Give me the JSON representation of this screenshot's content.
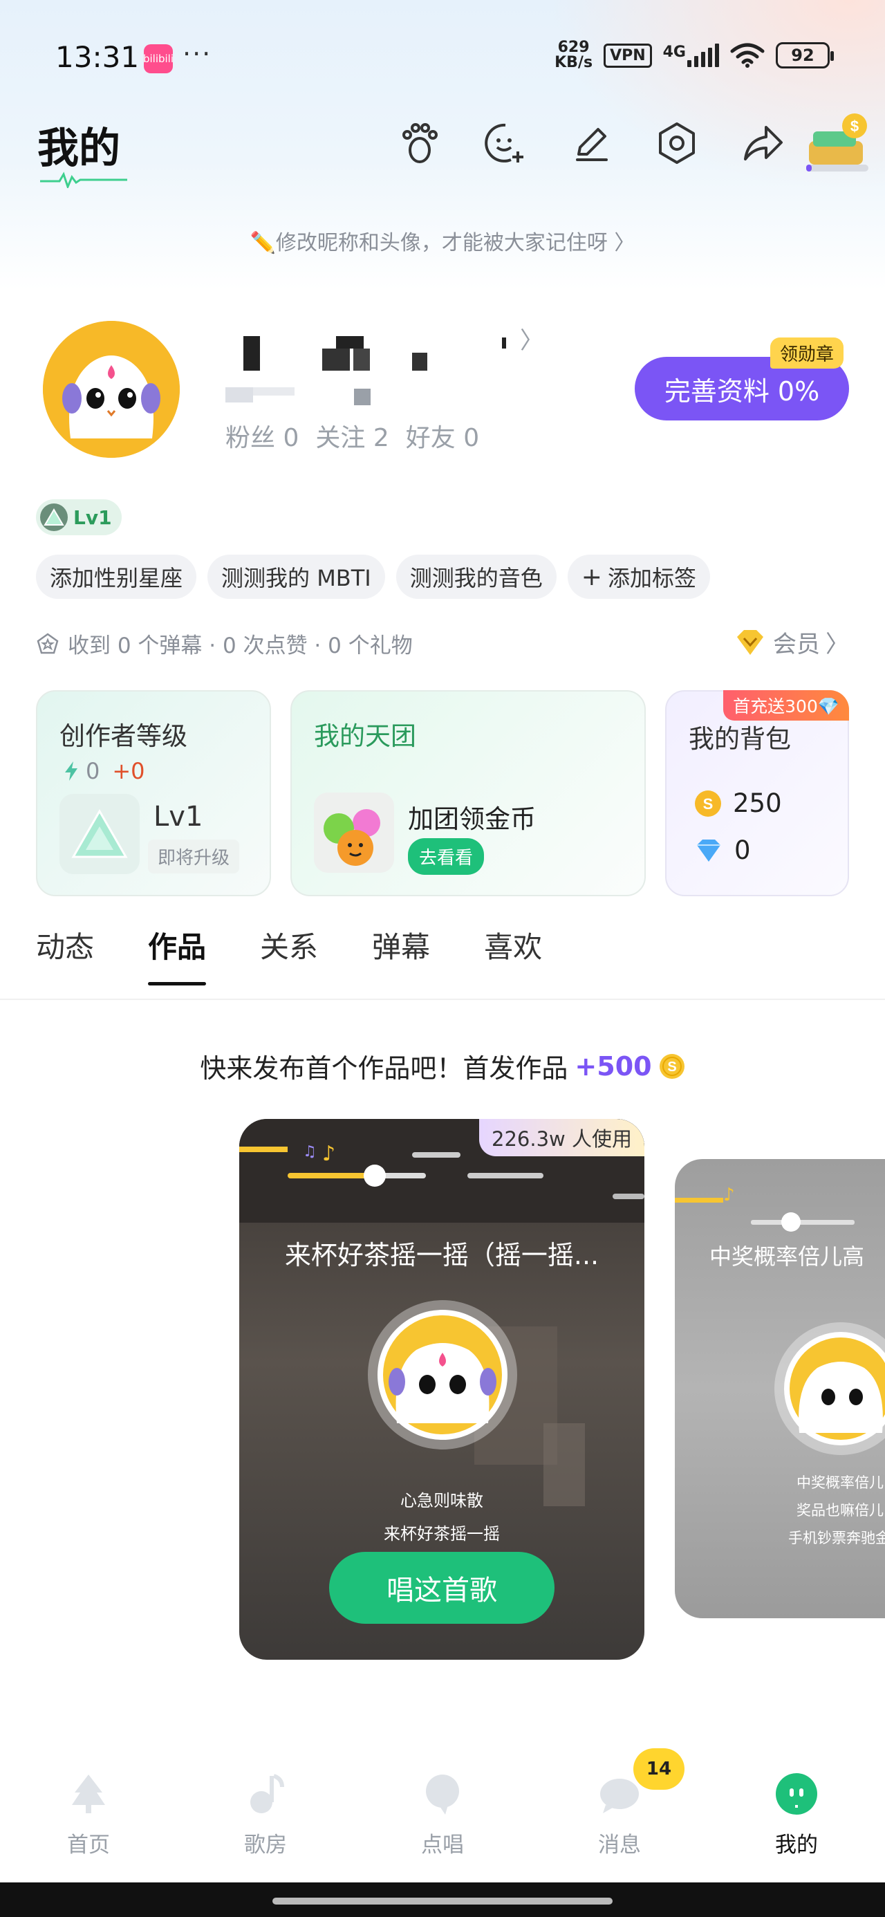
{
  "status_bar": {
    "time": "13:31",
    "app_icon_text": "bilibili",
    "more": "···",
    "net_speed_value": "629",
    "net_speed_unit": "KB/s",
    "vpn": "VPN",
    "signal": "4G",
    "battery": "92"
  },
  "header": {
    "title": "我的",
    "icons": [
      "footprint-icon",
      "add-friend-icon",
      "edit-icon",
      "settings-icon",
      "share-icon",
      "coin-pack-icon"
    ]
  },
  "tip": {
    "text": "✏️修改昵称和头像，才能被大家记住呀 〉"
  },
  "profile": {
    "username_arrow": "〉",
    "fans_label": "粉丝",
    "fans_count": "0",
    "following_label": "关注",
    "following_count": "2",
    "friends_label": "好友",
    "friends_count": "0",
    "complete_button": "完善资料 0%",
    "medal_tag": "领勋章",
    "level": "Lv1"
  },
  "tags": [
    "添加性别星座",
    "测测我的 MBTI",
    "测测我的音色",
    "添加标签"
  ],
  "stats_line": {
    "text": "收到 0 个弹幕 · 0 次点赞 · 0 个礼物",
    "vip_label": "会员",
    "vip_arrow": "〉"
  },
  "cards": {
    "creator": {
      "title": "创作者等级",
      "points": "0",
      "points_delta": "+0",
      "level": "Lv1",
      "level_hint": "即将升级"
    },
    "team": {
      "title": "我的天团",
      "subtitle": "加团领金币",
      "button": "去看看"
    },
    "bag": {
      "title": "我的背包",
      "promo": "首充送300💎",
      "coins": "250",
      "diamonds": "0"
    }
  },
  "tabs": [
    {
      "label": "动态",
      "active": false
    },
    {
      "label": "作品",
      "active": true
    },
    {
      "label": "关系",
      "active": false
    },
    {
      "label": "弹幕",
      "active": false
    },
    {
      "label": "喜欢",
      "active": false
    }
  ],
  "publish_tip": {
    "text": "快来发布首个作品吧！首发作品",
    "bonus": "+500"
  },
  "song_card_main": {
    "usage": "226.3w 人使用",
    "title": "来杯好茶摇一摇（摇一摇...",
    "lyric_1": "心急则味散",
    "lyric_2": "来杯好茶摇一摇",
    "button": "唱这首歌"
  },
  "song_card_next": {
    "title": "中奖概率倍儿高",
    "lyric_1": "中奖概率倍儿",
    "lyric_2": "奖品也嘛倍儿",
    "lyric_3": "手机钞票奔驰金"
  },
  "bottom_nav": [
    {
      "label": "首页",
      "icon": "home-tree-icon",
      "active": false
    },
    {
      "label": "歌房",
      "icon": "music-note-icon",
      "active": false
    },
    {
      "label": "点唱",
      "icon": "bubble-icon",
      "active": false
    },
    {
      "label": "消息",
      "icon": "chat-icon",
      "active": false,
      "badge": "14"
    },
    {
      "label": "我的",
      "icon": "me-face-icon",
      "active": true
    }
  ],
  "colors": {
    "accent_purple": "#7b55f5",
    "accent_green": "#1ec07a",
    "avatar_yellow": "#f7b928"
  }
}
